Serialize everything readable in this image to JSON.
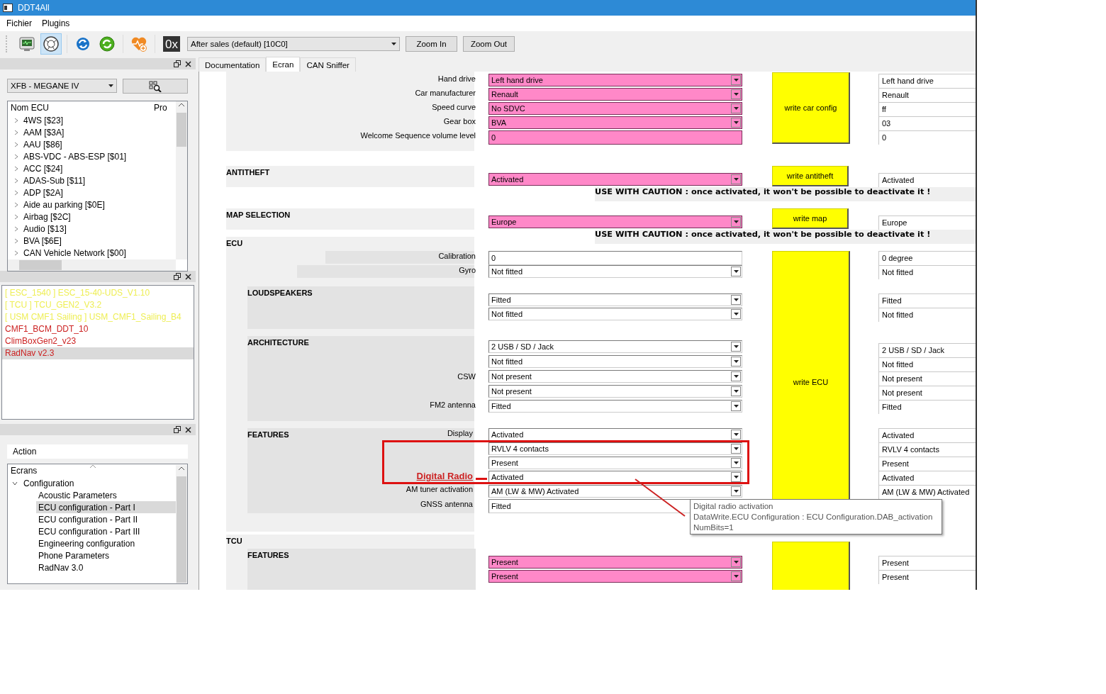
{
  "window": {
    "title": "DDT4All"
  },
  "menu": [
    {
      "label": "Fichier"
    },
    {
      "label": "Plugins"
    }
  ],
  "toolbar": {
    "tools": [
      {
        "kind": "monitor",
        "selected": false
      },
      {
        "kind": "emblem",
        "selected": true
      },
      {
        "kind": "refresh",
        "selected": false
      },
      {
        "kind": "sync",
        "selected": false
      },
      {
        "kind": "health",
        "selected": false
      },
      {
        "kind": "hex",
        "label": "0x"
      }
    ],
    "mode_select": "After sales (default) [10C0]",
    "buttons": [
      "Zoom In",
      "Zoom Out"
    ]
  },
  "ecu_dock": {
    "vehicle_select": "XFB - MEGANE IV",
    "columns": [
      "Nom ECU",
      "Pro"
    ],
    "items": [
      {
        "label": "4WS [$23]",
        "expanded": false
      },
      {
        "label": "AAM [$3A]",
        "expanded": false
      },
      {
        "label": "AAU [$86]",
        "expanded": false
      },
      {
        "label": "ABS-VDC - ABS-ESP [$01]",
        "expanded": false
      },
      {
        "label": "ACC [$24]",
        "expanded": false
      },
      {
        "label": "ADAS-Sub [$11]",
        "expanded": false
      },
      {
        "label": "ADP [$2A]",
        "expanded": false
      },
      {
        "label": "Aide au parking [$0E]",
        "expanded": false
      },
      {
        "label": "Airbag [$2C]",
        "expanded": false
      },
      {
        "label": "Audio [$13]",
        "expanded": false
      },
      {
        "label": "BVA [$6E]",
        "expanded": false
      },
      {
        "label": "CAN Vehicle Network [$00]",
        "expanded": false
      }
    ]
  },
  "ecu_list": {
    "items": [
      {
        "label": "[ ESC_1540 ] ESC_15-40-UDS_V1.10",
        "color": "#eeee55",
        "selected": false
      },
      {
        "label": "[ TCU ] TCU_GEN2_V3.2",
        "color": "#eeee55",
        "selected": false
      },
      {
        "label": "[ USM CMF1 Sailing ] USM_CMF1_Sailing_B4",
        "color": "#eeee55",
        "selected": false
      },
      {
        "label": "CMF1_BCM_DDT_10",
        "color": "#cc2222",
        "selected": false
      },
      {
        "label": "ClimBoxGen2_v23",
        "color": "#cc2222",
        "selected": false
      },
      {
        "label": "RadNav v2.3",
        "color": "#cc2222",
        "selected": true
      }
    ]
  },
  "screens_dock": {
    "page": "Action",
    "header": "Ecrans",
    "items": [
      {
        "label": "Configuration",
        "expanded": true,
        "selected": false,
        "children": [
          {
            "label": "Acoustic Parameters",
            "selected": false
          },
          {
            "label": "ECU configuration - Part I",
            "selected": true
          },
          {
            "label": "ECU configuration - Part II",
            "selected": false
          },
          {
            "label": "ECU configuration - Part III",
            "selected": false
          },
          {
            "label": "Engineering configuration",
            "selected": false
          },
          {
            "label": "Phone Parameters",
            "selected": false
          },
          {
            "label": "RadNav 3.0",
            "selected": false
          }
        ]
      }
    ]
  },
  "tabs": [
    {
      "label": "Documentation",
      "selected": false
    },
    {
      "label": "Ecran",
      "selected": true
    },
    {
      "label": "CAN Sniffer",
      "selected": false
    }
  ],
  "form": {
    "panels": [
      {
        "kind": "group"
      },
      {
        "kind": "group",
        "title": "ANTITHEFT"
      },
      {
        "kind": "group",
        "title": "MAP SELECTION"
      },
      {
        "kind": "group",
        "title": "ECU"
      },
      {
        "kind": "band"
      },
      {
        "kind": "band"
      },
      {
        "kind": "subgroup",
        "title": "LOUDSPEAKERS"
      },
      {
        "kind": "subgroup",
        "title": "ARCHITECTURE"
      },
      {
        "kind": "subgroup",
        "title": "FEATURES"
      },
      {
        "kind": "group",
        "title": "TCU"
      },
      {
        "kind": "subgroup",
        "title": "FEATURES"
      }
    ],
    "labels": [
      "Hand drive",
      "Car manufacturer",
      "Speed curve",
      "Gear box",
      "Welcome Sequence volume level",
      "Calibration",
      "Gyro",
      "CSW",
      "FM2 antenna",
      "Display",
      "AM tuner activation",
      "GNSS antenna"
    ],
    "fields": [
      {
        "kind": "combo",
        "value": "Left hand drive",
        "highlighted": true
      },
      {
        "kind": "combo",
        "value": "Renault",
        "highlighted": true
      },
      {
        "kind": "combo",
        "value": "No SDVC",
        "highlighted": true
      },
      {
        "kind": "combo",
        "value": "BVA",
        "highlighted": true
      },
      {
        "kind": "input",
        "value": "0",
        "highlighted": true
      },
      {
        "kind": "combo",
        "value": "Activated",
        "highlighted": true
      },
      {
        "kind": "combo",
        "value": "Europe",
        "highlighted": true
      },
      {
        "kind": "input",
        "value": "0",
        "highlighted": false
      },
      {
        "kind": "combo",
        "value": "Not fitted",
        "highlighted": false
      },
      {
        "kind": "combo",
        "value": "Fitted",
        "highlighted": false
      },
      {
        "kind": "combo",
        "value": "Not fitted",
        "highlighted": false
      },
      {
        "kind": "combo",
        "value": "2 USB / SD / Jack",
        "highlighted": false
      },
      {
        "kind": "combo",
        "value": "Not fitted",
        "highlighted": false
      },
      {
        "kind": "combo",
        "value": "Not present",
        "highlighted": false
      },
      {
        "kind": "combo",
        "value": "Not present",
        "highlighted": false
      },
      {
        "kind": "combo",
        "value": "Fitted",
        "highlighted": false
      },
      {
        "kind": "combo",
        "value": "Activated",
        "highlighted": false
      },
      {
        "kind": "combo",
        "value": "RVLV 4 contacts",
        "highlighted": false
      },
      {
        "kind": "combo",
        "value": "Present",
        "highlighted": false
      },
      {
        "kind": "combo",
        "value": "Activated",
        "highlighted": false
      },
      {
        "kind": "combo",
        "value": "AM (LW & MW) Activated",
        "highlighted": false
      },
      {
        "kind": "input",
        "value": "Fitted",
        "highlighted": false
      },
      {
        "kind": "combo",
        "value": "Present",
        "highlighted": true
      },
      {
        "kind": "combo",
        "value": "Present",
        "highlighted": true
      }
    ],
    "buttons": [
      {
        "kind": "write",
        "label": "write car config"
      },
      {
        "kind": "write",
        "label": "write antitheft"
      },
      {
        "kind": "write",
        "label": "write map"
      },
      {
        "kind": "write",
        "label": "write ECU"
      },
      {
        "kind": "write"
      }
    ],
    "values": [
      "Left hand drive",
      "Renault",
      "ff",
      "03",
      "0",
      "Activated",
      "Europe",
      "0 degree",
      "Not fitted",
      "Fitted",
      "Not fitted",
      "2 USB / SD / Jack",
      "Not fitted",
      "Not present",
      "Not present",
      "Fitted",
      "Activated",
      "RVLV 4 contacts",
      "Present",
      "Activated",
      "AM (LW & MW) Activated",
      "Present",
      "Present"
    ],
    "warnings": [
      "USE WITH CAUTION : once activated, it won't be possible to deactivate it !",
      "USE WITH CAUTION : once activated, it won't be possible to deactivate it !"
    ]
  },
  "annotation": {
    "label": "Digital Radio"
  },
  "tooltip": {
    "lines": [
      "Digital radio activation",
      "DataWrite.ECU Configuration : ECU Configuration.DAB_activation",
      "NumBits=1"
    ]
  }
}
